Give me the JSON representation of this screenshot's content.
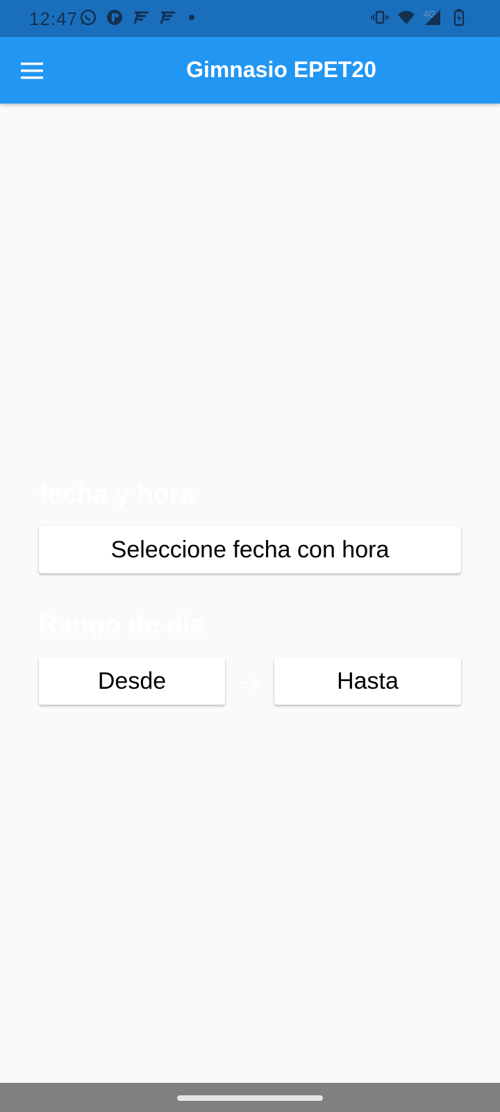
{
  "status_bar": {
    "time": "12:47",
    "left_icons": [
      "whatsapp-icon",
      "app-icon",
      "app-f-icon",
      "app-f-icon",
      "notification-dot-icon"
    ],
    "right_icons": [
      "vibrate-icon",
      "wifi-icon",
      "cell-signal-icon",
      "battery-charging-icon"
    ],
    "network_label": "4G"
  },
  "app_bar": {
    "title": "Gimnasio EPET20",
    "menu_icon": "hamburger-menu-icon",
    "color": "#2196f3"
  },
  "content": {
    "datetime_section_label": "fecha y hora",
    "datetime_button_label": "Seleccione fecha con hora",
    "range_section_label": "Rango de dia",
    "from_button_label": "Desde",
    "arrow_icon": "arrow-right-icon",
    "to_button_label": "Hasta"
  },
  "colors": {
    "status_bar": "#1a6fbd",
    "background": "#fafafa",
    "nav_bar": "#808080"
  }
}
